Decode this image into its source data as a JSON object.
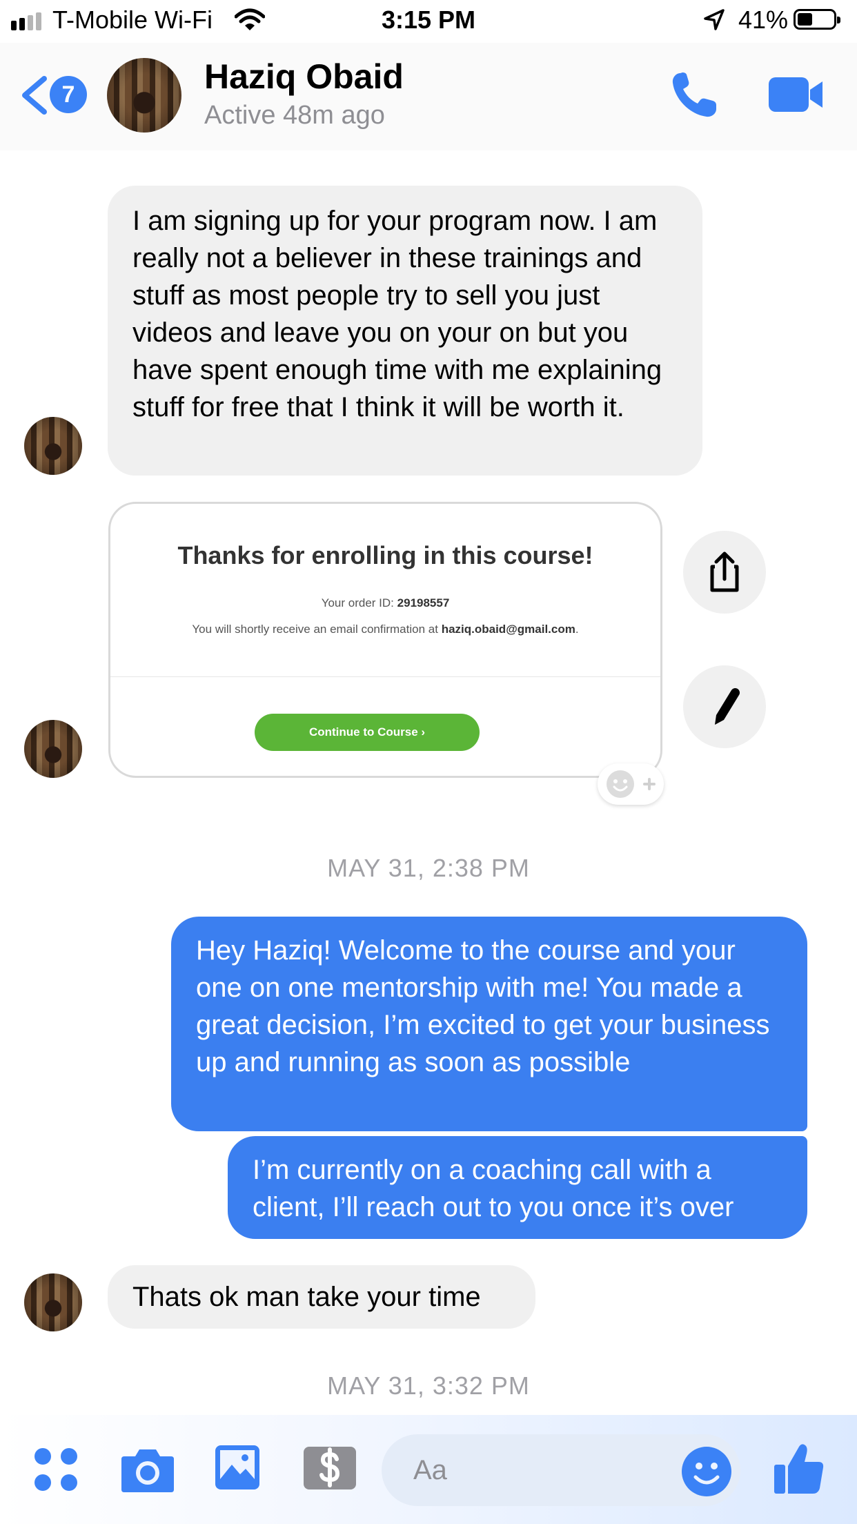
{
  "status_bar": {
    "carrier": "T-Mobile Wi-Fi",
    "time": "3:15 PM",
    "battery": "41%",
    "battery_level": 0.41
  },
  "header": {
    "back_count": "7",
    "name": "Haziq Obaid",
    "status": "Active 48m ago",
    "icons": [
      "back-chevron-icon",
      "phone-icon",
      "video-camera-icon"
    ]
  },
  "messages": [
    {
      "from": "incoming",
      "text": "I am signing up for your program now. I am really not a believer in these trainings and stuff as most people try to sell you just videos and leave you on your on but you have spent enough time with me explaining stuff for free that I think it will be worth it."
    },
    {
      "from": "incoming",
      "type": "image",
      "card": {
        "title": "Thanks for enrolling in this course!",
        "order_label": "Your order ID:",
        "order_id": "29198557",
        "email_prefix": "You will shortly receive an email confirmation at",
        "email": "haziq.obaid@gmail.com",
        "email_suffix": ".",
        "button": "Continue to Course ›"
      }
    },
    {
      "type": "timestamp",
      "text": "MAY 31, 2:38 PM"
    },
    {
      "from": "outgoing",
      "text": "Hey Haziq! Welcome to the course and your one on one mentorship with me! You made a great decision, I’m excited to get your business up and running as soon as possible"
    },
    {
      "from": "outgoing",
      "text": "I’m currently on a coaching call with a client, I’ll reach out to you once it’s over"
    },
    {
      "from": "incoming",
      "text": "Thats ok man take your time"
    },
    {
      "type": "timestamp",
      "text": "MAY 31, 3:32 PM"
    }
  ],
  "composer": {
    "placeholder": "Aa",
    "icons": [
      "apps-icon",
      "camera-icon",
      "photo-icon",
      "payment-icon",
      "emoji-icon",
      "thumbs-up-icon"
    ]
  },
  "colors": {
    "accent": "#3b82f6",
    "outgoing_bubble": "#3b7ff0",
    "incoming_bubble": "#f0f0f0",
    "card_button": "#5bb537"
  }
}
